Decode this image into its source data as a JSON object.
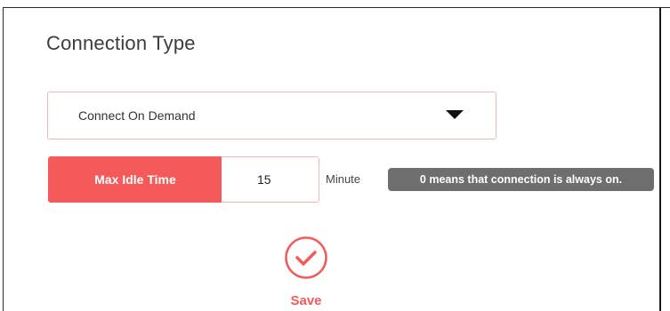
{
  "section": {
    "title": "Connection Type"
  },
  "connection_select": {
    "selected": "Connect On Demand",
    "icon": "dropdown-arrow-icon"
  },
  "idle": {
    "label": "Max Idle Time",
    "value": "15",
    "unit": "Minute",
    "hint": "0 means that connection is always on."
  },
  "save": {
    "label": "Save",
    "icon": "check-circle-icon"
  },
  "colors": {
    "accent": "#f55a5a",
    "input_border": "#f2b5b5",
    "hint_bg": "#6e6e6e"
  }
}
